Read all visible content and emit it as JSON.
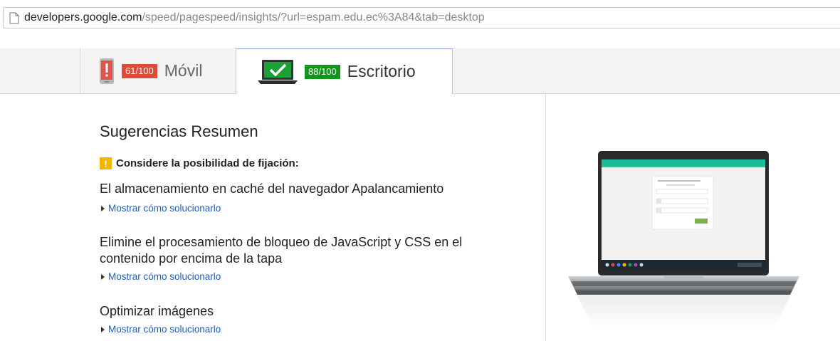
{
  "address_bar": {
    "host": "developers.google.com",
    "path": "/speed/pagespeed/insights/?url=espam.edu.ec%3A84&tab=desktop"
  },
  "tabs": [
    {
      "label": "Móvil",
      "score": "61/100",
      "status": "warning",
      "icon": "phone-warning-icon"
    },
    {
      "label": "Escritorio",
      "score": "88/100",
      "status": "good",
      "icon": "laptop-check-icon",
      "selected": true
    }
  ],
  "colors": {
    "score_red": "#dd4b39",
    "score_green": "#109618",
    "warning": "#f4b400",
    "link": "#1a5fbf"
  },
  "summary": {
    "title": "Sugerencias Resumen",
    "warning_heading": "Considere la posibilidad de fijación:",
    "rules": [
      {
        "title": "El almacenamiento en caché del navegador Apalancamiento",
        "link": "Mostrar cómo solucionarlo"
      },
      {
        "title": "Elimine el procesamiento de bloqueo de JavaScript y CSS en el contenido por encima de la tapa",
        "link": "Mostrar cómo solucionarlo"
      },
      {
        "title": "Optimizar imágenes",
        "link": "Mostrar cómo solucionarlo"
      }
    ]
  },
  "preview": {
    "icon": "laptop-preview-image"
  }
}
